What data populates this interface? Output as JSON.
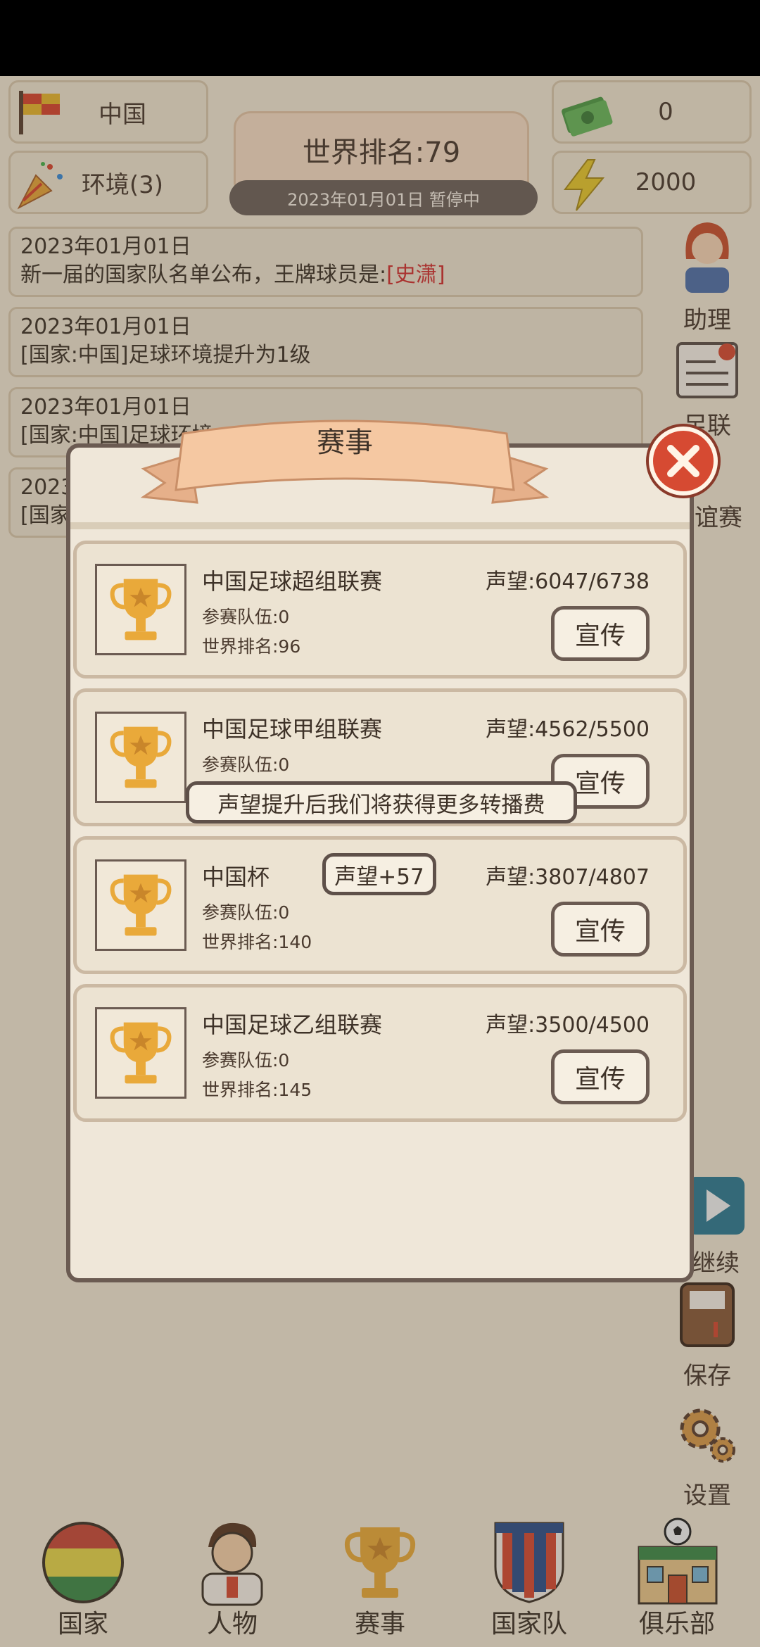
{
  "top": {
    "country": "中国",
    "environment": "环境(3)",
    "money": "0",
    "energy": "2000",
    "world_rank": "世界排名:79",
    "date_status": "2023年01月01日 暂停中"
  },
  "logs": [
    {
      "date": "2023年01月01日",
      "text_prefix": "新一届的国家队名单公布，王牌球员是:",
      "highlight": "[史潇]"
    },
    {
      "date": "2023年01月01日",
      "text_prefix": "[国家:中国]足球环境提升为1级",
      "highlight": ""
    },
    {
      "date": "2023年01月01日",
      "text_prefix": "[国家:中国]足球环境",
      "highlight": ""
    },
    {
      "date": "2023",
      "text_prefix": "[国家",
      "highlight": ""
    }
  ],
  "side": {
    "assistant": "助理",
    "league": "足联",
    "friendly": "谊赛",
    "continue": "继续",
    "save": "保存",
    "settings": "设置"
  },
  "dialog": {
    "title": "赛事",
    "competitions": [
      {
        "name": "中国足球超组联赛",
        "teams": "参赛队伍:0",
        "rank": "世界排名:96",
        "reputation": "声望:6047/6738",
        "button": "宣传"
      },
      {
        "name": "中国足球甲组联赛",
        "teams": "参赛队伍:0",
        "rank": "",
        "reputation": "声望:4562/5500",
        "button": "宣传"
      },
      {
        "name": "中国杯",
        "teams": "参赛队伍:0",
        "rank": "世界排名:140",
        "reputation": "声望:3807/4807",
        "button": "宣传"
      },
      {
        "name": "中国足球乙组联赛",
        "teams": "参赛队伍:0",
        "rank": "世界排名:145",
        "reputation": "声望:3500/4500",
        "button": "宣传"
      }
    ],
    "tooltip": "声望提升后我们将获得更多转播费",
    "gain_badge": "声望+57"
  },
  "nav": [
    "国家",
    "人物",
    "赛事",
    "国家队",
    "俱乐部"
  ],
  "colors": {
    "accent_red": "#d13030",
    "close_red": "#d64a32",
    "trophy_gold": "#e9a93a"
  }
}
